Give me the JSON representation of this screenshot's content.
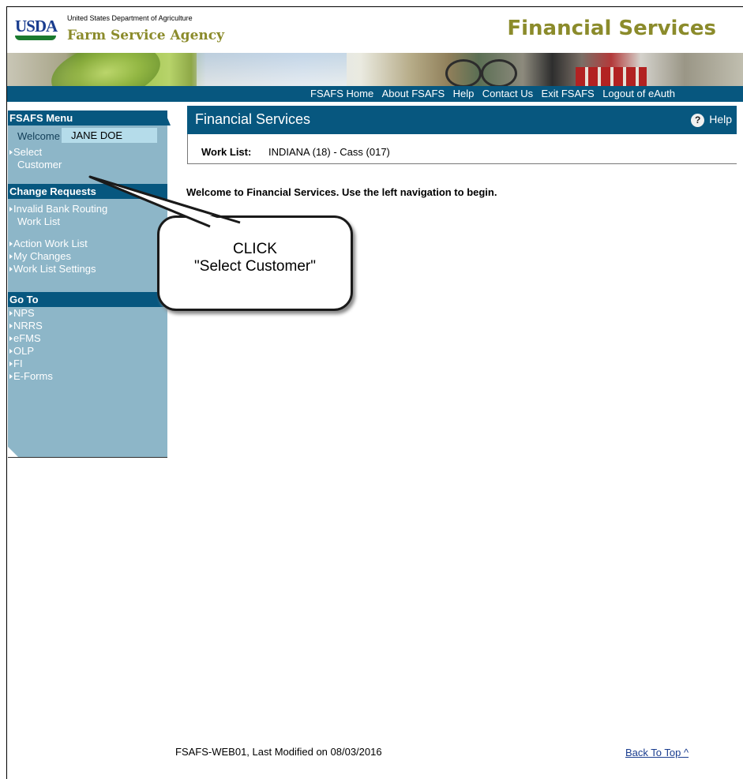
{
  "header": {
    "logo_text": "USDA",
    "department": "United States Department of Agriculture",
    "agency": "Farm Service Agency",
    "site_title": "Financial Services"
  },
  "nav": {
    "links": [
      "FSAFS Home",
      "About FSAFS",
      "Help",
      "Contact Us",
      "Exit FSAFS",
      "Logout of eAuth"
    ]
  },
  "sidebar": {
    "menu_title": "FSAFS Menu",
    "welcome_label": "Welcome",
    "user_name": "JANE DOE",
    "select_customer_1": "Select",
    "select_customer_2": "Customer",
    "change_requests_title": "Change Requests",
    "invalid_bank_1": "Invalid Bank Routing",
    "invalid_bank_2": "Work List",
    "action_work_list": "Action Work List",
    "my_changes": "My Changes",
    "work_list_settings": "Work List Settings",
    "goto_title": "Go To",
    "goto_items": [
      "NPS",
      "NRRS",
      "eFMS",
      "OLP",
      "FI",
      "E-Forms"
    ]
  },
  "main": {
    "page_title": "Financial Services",
    "help_label": "Help",
    "help_icon": "?",
    "worklist_label": "Work List:",
    "worklist_value": "INDIANA (18) - Cass (017)",
    "welcome_message": "Welcome to Financial Services. Use the left navigation to begin."
  },
  "callout": {
    "line1": "CLICK",
    "line2": "\"Select Customer\""
  },
  "footer": {
    "text": "FSAFS-WEB01, Last Modified on 08/03/2016",
    "back_to_top": "Back To Top ^"
  },
  "colors": {
    "nav_blue": "#07577f",
    "menu_bg": "#8db6c8",
    "olive_title": "#8b8b2b"
  }
}
